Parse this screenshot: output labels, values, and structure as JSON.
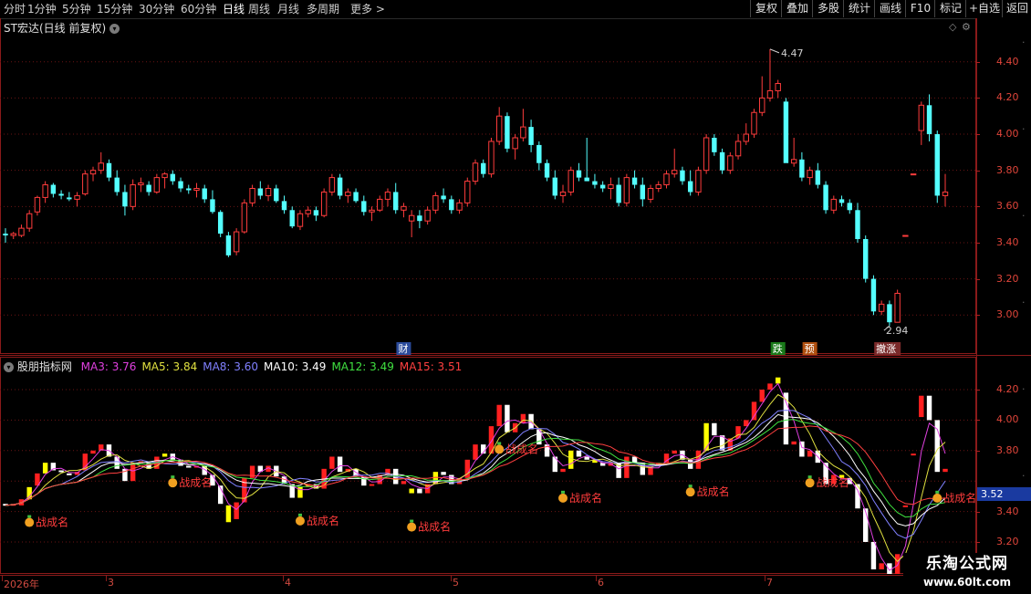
{
  "toolbar": {
    "periods": [
      "分时",
      "1分钟",
      "5分钟",
      "15分钟",
      "30分钟",
      "60分钟",
      "日线",
      "周线",
      "月线",
      "多周期",
      "更多 >"
    ],
    "active_period": "日线",
    "buttons": [
      "复权",
      "叠加",
      "多股",
      "统计",
      "画线",
      "F10",
      "标记",
      "+自选",
      "返回"
    ]
  },
  "upper": {
    "title": "ST宏达(日线 前复权)",
    "max_label": "4.47",
    "min_label": "2.94",
    "event_labels": [
      "财",
      "跌",
      "预",
      "撤涨"
    ],
    "y_ticks": [
      "4.40",
      "4.20",
      "4.00",
      "3.80",
      "3.60",
      "3.40",
      "3.20",
      "3.00"
    ]
  },
  "lower": {
    "indicator_name": "股朋指标网",
    "ma": [
      {
        "label": "MA3: 3.76",
        "color": "#e040e0"
      },
      {
        "label": "MA5: 3.84",
        "color": "#e0e040"
      },
      {
        "label": "MA8: 3.60",
        "color": "#8080ff"
      },
      {
        "label": "MA10: 3.49",
        "color": "#ffffff"
      },
      {
        "label": "MA12: 3.49",
        "color": "#40e040"
      },
      {
        "label": "MA15: 3.51",
        "color": "#ff4040"
      }
    ],
    "y_ticks": [
      "4.20",
      "4.00",
      "3.80",
      "3.52",
      "3.40",
      "3.20"
    ],
    "current_price": "3.52",
    "signal_label": "战成名"
  },
  "date_axis": [
    "2026年",
    "3",
    "4",
    "5",
    "6",
    "7"
  ],
  "watermark": {
    "title": "乐淘公式网",
    "url": "www.60lt.com"
  },
  "colors": {
    "up": "#ff3c3c",
    "down": "#54ffff",
    "grid": "#8a1a1a",
    "ytext": "#e0453a"
  },
  "chart_data": {
    "type": "candlestick",
    "series_name": "ST宏达",
    "x": [
      "2026-02"
    ],
    "ylim_upper": [
      2.85,
      4.55
    ],
    "ylim_lower": [
      3.05,
      4.32
    ],
    "candles": [
      [
        3.45,
        3.48,
        3.4,
        3.44
      ],
      [
        3.44,
        3.46,
        3.42,
        3.45
      ],
      [
        3.44,
        3.5,
        3.43,
        3.48
      ],
      [
        3.48,
        3.58,
        3.46,
        3.56
      ],
      [
        3.57,
        3.66,
        3.55,
        3.65
      ],
      [
        3.65,
        3.74,
        3.62,
        3.72
      ],
      [
        3.72,
        3.73,
        3.65,
        3.67
      ],
      [
        3.67,
        3.69,
        3.64,
        3.66
      ],
      [
        3.65,
        3.68,
        3.63,
        3.64
      ],
      [
        3.64,
        3.68,
        3.6,
        3.66
      ],
      [
        3.67,
        3.8,
        3.66,
        3.78
      ],
      [
        3.78,
        3.82,
        3.74,
        3.8
      ],
      [
        3.8,
        3.9,
        3.78,
        3.84
      ],
      [
        3.84,
        3.86,
        3.74,
        3.76
      ],
      [
        3.76,
        3.8,
        3.66,
        3.68
      ],
      [
        3.68,
        3.72,
        3.55,
        3.6
      ],
      [
        3.6,
        3.75,
        3.58,
        3.72
      ],
      [
        3.72,
        3.76,
        3.68,
        3.73
      ],
      [
        3.72,
        3.74,
        3.66,
        3.68
      ],
      [
        3.68,
        3.78,
        3.67,
        3.76
      ],
      [
        3.76,
        3.79,
        3.7,
        3.78
      ],
      [
        3.78,
        3.8,
        3.72,
        3.74
      ],
      [
        3.74,
        3.76,
        3.68,
        3.7
      ],
      [
        3.7,
        3.72,
        3.67,
        3.69
      ],
      [
        3.69,
        3.73,
        3.65,
        3.7
      ],
      [
        3.7,
        3.72,
        3.62,
        3.64
      ],
      [
        3.64,
        3.69,
        3.56,
        3.57
      ],
      [
        3.57,
        3.58,
        3.43,
        3.45
      ],
      [
        3.44,
        3.46,
        3.32,
        3.33
      ],
      [
        3.35,
        3.48,
        3.33,
        3.46
      ],
      [
        3.46,
        3.64,
        3.45,
        3.62
      ],
      [
        3.62,
        3.72,
        3.6,
        3.7
      ],
      [
        3.7,
        3.74,
        3.64,
        3.66
      ],
      [
        3.66,
        3.72,
        3.63,
        3.7
      ],
      [
        3.7,
        3.72,
        3.62,
        3.63
      ],
      [
        3.63,
        3.66,
        3.56,
        3.58
      ],
      [
        3.58,
        3.6,
        3.48,
        3.49
      ],
      [
        3.49,
        3.58,
        3.47,
        3.56
      ],
      [
        3.56,
        3.6,
        3.54,
        3.58
      ],
      [
        3.58,
        3.6,
        3.52,
        3.55
      ],
      [
        3.55,
        3.7,
        3.54,
        3.68
      ],
      [
        3.68,
        3.78,
        3.66,
        3.76
      ],
      [
        3.76,
        3.78,
        3.64,
        3.66
      ],
      [
        3.66,
        3.7,
        3.62,
        3.68
      ],
      [
        3.68,
        3.7,
        3.62,
        3.63
      ],
      [
        3.63,
        3.66,
        3.55,
        3.57
      ],
      [
        3.57,
        3.6,
        3.52,
        3.58
      ],
      [
        3.58,
        3.66,
        3.57,
        3.64
      ],
      [
        3.64,
        3.7,
        3.6,
        3.68
      ],
      [
        3.68,
        3.73,
        3.56,
        3.58
      ],
      [
        3.58,
        3.62,
        3.54,
        3.6
      ],
      [
        3.52,
        3.58,
        3.43,
        3.55
      ],
      [
        3.55,
        3.58,
        3.48,
        3.52
      ],
      [
        3.52,
        3.6,
        3.5,
        3.58
      ],
      [
        3.58,
        3.68,
        3.56,
        3.66
      ],
      [
        3.66,
        3.7,
        3.62,
        3.64
      ],
      [
        3.64,
        3.66,
        3.56,
        3.58
      ],
      [
        3.58,
        3.64,
        3.56,
        3.62
      ],
      [
        3.62,
        3.76,
        3.6,
        3.74
      ],
      [
        3.74,
        3.86,
        3.72,
        3.84
      ],
      [
        3.84,
        3.86,
        3.76,
        3.78
      ],
      [
        3.78,
        3.98,
        3.76,
        3.96
      ],
      [
        3.96,
        4.15,
        3.94,
        4.1
      ],
      [
        4.1,
        4.12,
        3.9,
        3.92
      ],
      [
        3.92,
        4.0,
        3.86,
        3.98
      ],
      [
        3.98,
        4.14,
        3.96,
        4.04
      ],
      [
        4.04,
        4.08,
        3.9,
        3.94
      ],
      [
        3.94,
        3.96,
        3.8,
        3.84
      ],
      [
        3.84,
        3.86,
        3.74,
        3.76
      ],
      [
        3.76,
        3.8,
        3.64,
        3.66
      ],
      [
        3.66,
        3.72,
        3.62,
        3.68
      ],
      [
        3.68,
        3.82,
        3.66,
        3.8
      ],
      [
        3.8,
        3.84,
        3.74,
        3.76
      ],
      [
        3.76,
        3.98,
        3.74,
        3.74
      ],
      [
        3.74,
        3.78,
        3.7,
        3.72
      ],
      [
        3.72,
        3.74,
        3.68,
        3.7
      ],
      [
        3.7,
        3.76,
        3.64,
        3.72
      ],
      [
        3.72,
        3.76,
        3.6,
        3.62
      ],
      [
        3.62,
        3.78,
        3.6,
        3.76
      ],
      [
        3.76,
        3.8,
        3.7,
        3.72
      ],
      [
        3.72,
        3.76,
        3.6,
        3.64
      ],
      [
        3.64,
        3.72,
        3.62,
        3.7
      ],
      [
        3.7,
        3.74,
        3.68,
        3.72
      ],
      [
        3.72,
        3.8,
        3.7,
        3.78
      ],
      [
        3.78,
        3.92,
        3.76,
        3.8
      ],
      [
        3.8,
        3.82,
        3.72,
        3.74
      ],
      [
        3.74,
        3.8,
        3.66,
        3.68
      ],
      [
        3.68,
        3.82,
        3.66,
        3.8
      ],
      [
        3.8,
        4.0,
        3.78,
        3.98
      ],
      [
        3.98,
        4.0,
        3.88,
        3.9
      ],
      [
        3.9,
        3.92,
        3.78,
        3.8
      ],
      [
        3.8,
        3.9,
        3.78,
        3.88
      ],
      [
        3.88,
        4.0,
        3.86,
        3.96
      ],
      [
        3.96,
        4.06,
        3.94,
        4.0
      ],
      [
        4.0,
        4.14,
        3.98,
        4.12
      ],
      [
        4.12,
        4.32,
        4.1,
        4.2
      ],
      [
        4.2,
        4.47,
        4.18,
        4.24
      ],
      [
        4.24,
        4.3,
        4.2,
        4.28
      ],
      [
        4.18,
        4.2,
        3.98,
        3.84
      ],
      [
        3.84,
        3.98,
        3.82,
        3.86
      ],
      [
        3.86,
        3.9,
        3.74,
        3.76
      ],
      [
        3.76,
        3.82,
        3.72,
        3.8
      ],
      [
        3.8,
        3.84,
        3.7,
        3.72
      ],
      [
        3.72,
        3.74,
        3.56,
        3.58
      ],
      [
        3.58,
        3.66,
        3.56,
        3.64
      ],
      [
        3.64,
        3.66,
        3.6,
        3.62
      ],
      [
        3.62,
        3.64,
        3.56,
        3.58
      ],
      [
        3.58,
        3.62,
        3.4,
        3.42
      ],
      [
        3.42,
        3.44,
        3.18,
        3.2
      ],
      [
        3.2,
        3.22,
        3.0,
        3.02
      ],
      [
        3.02,
        3.08,
        3.0,
        3.06
      ],
      [
        3.06,
        3.08,
        2.94,
        2.96
      ],
      [
        2.96,
        3.14,
        2.96,
        3.12
      ],
      [
        3.44,
        3.44,
        3.44,
        3.44
      ],
      [
        3.78,
        3.78,
        3.78,
        3.78
      ],
      [
        4.02,
        4.18,
        3.94,
        4.16
      ],
      [
        4.16,
        4.22,
        3.96,
        4.0
      ],
      [
        4.0,
        4.02,
        3.62,
        3.66
      ],
      [
        3.66,
        3.78,
        3.6,
        3.68
      ]
    ],
    "signals_at_index": [
      3,
      21,
      37,
      51,
      62,
      70,
      86,
      101,
      117
    ],
    "ma_periods": [
      3,
      5,
      8,
      10,
      12,
      15
    ]
  }
}
